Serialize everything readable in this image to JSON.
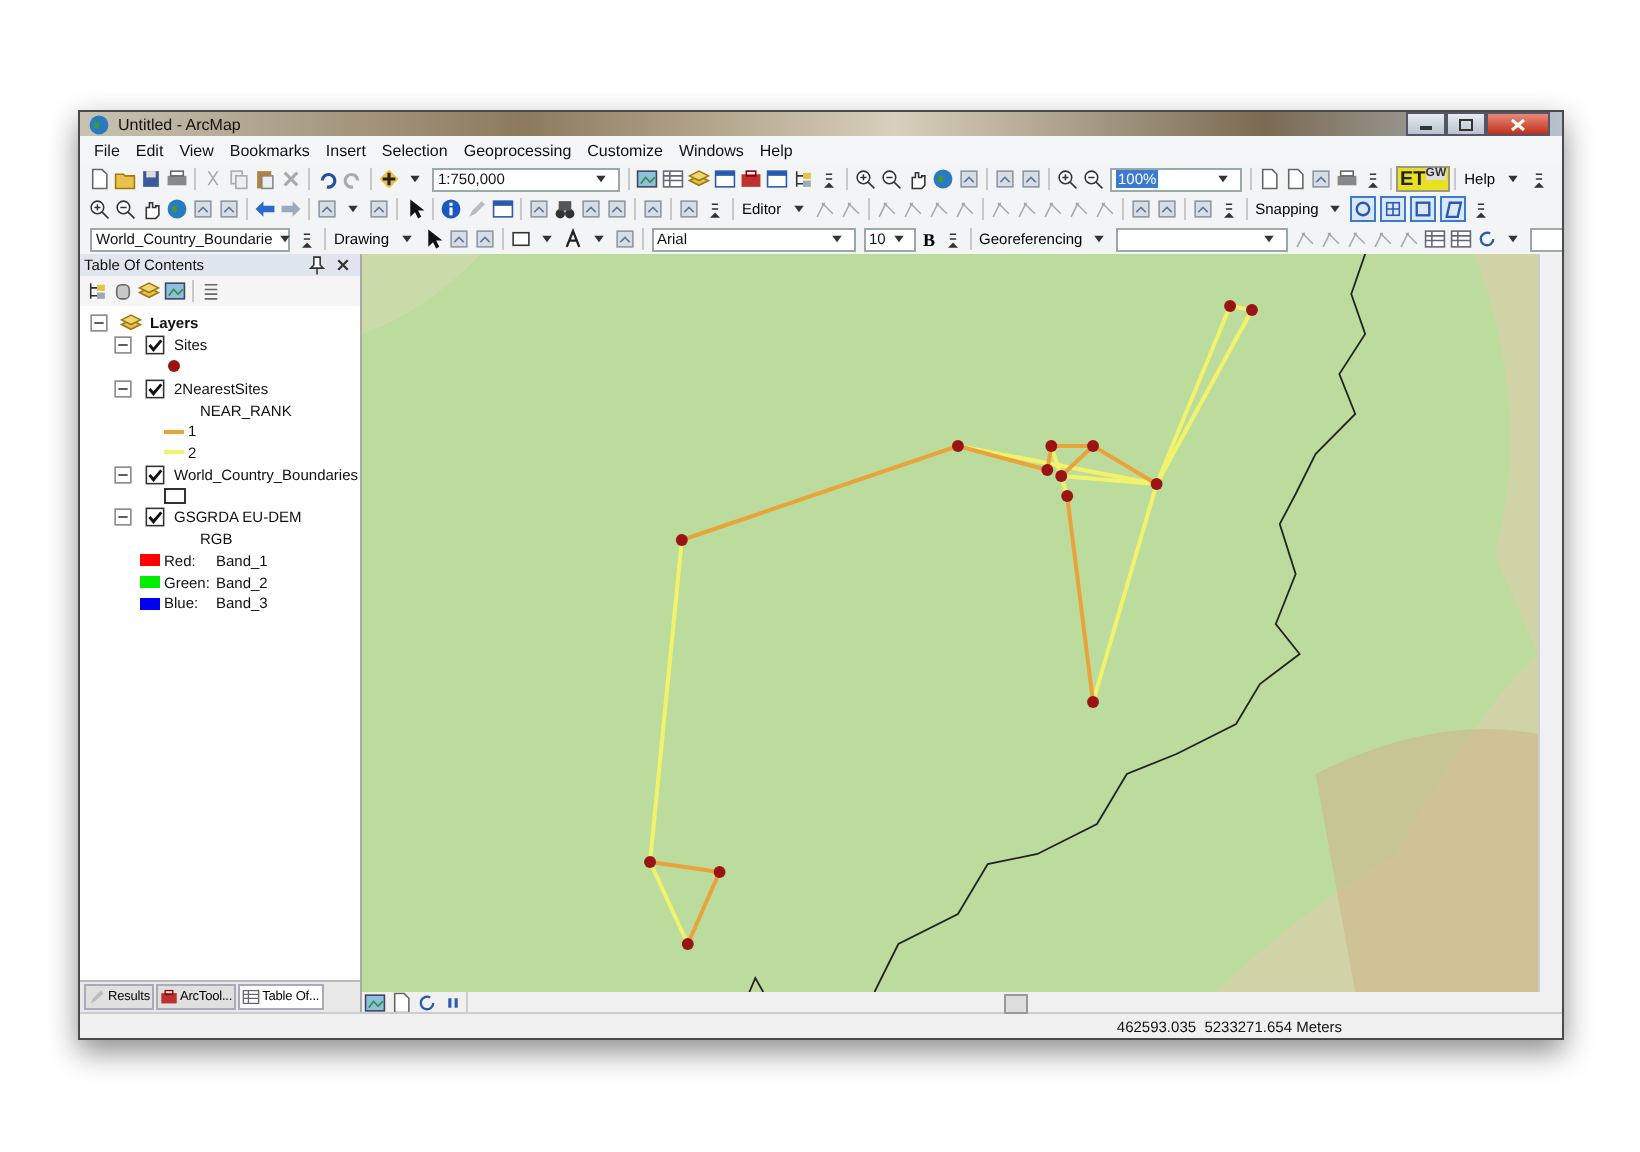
{
  "window": {
    "title": "Untitled - ArcMap"
  },
  "menu": [
    "File",
    "Edit",
    "View",
    "Bookmarks",
    "Insert",
    "Selection",
    "Geoprocessing",
    "Customize",
    "Windows",
    "Help"
  ],
  "toolbars": [
    {
      "items": [
        {
          "kind": "field",
          "value": "1:750,000"
        },
        {
          "kind": "field",
          "value": "100%"
        },
        {
          "kind": "logo",
          "label": "ET",
          "sup": "GW"
        },
        {
          "kind": "menu",
          "label": "Help"
        }
      ]
    },
    {
      "items": [
        {
          "kind": "menu",
          "label": "Editor"
        },
        {
          "kind": "menu",
          "label": "Snapping"
        }
      ]
    },
    {
      "items": [
        {
          "kind": "field",
          "value": "World_Country_Boundarie"
        },
        {
          "kind": "menu",
          "label": "Drawing"
        },
        {
          "kind": "field",
          "value": "Arial"
        },
        {
          "kind": "field",
          "value": "10"
        },
        {
          "kind": "button",
          "label": "B"
        },
        {
          "kind": "menu",
          "label": "Georeferencing"
        },
        {
          "kind": "field",
          "value": ""
        },
        {
          "kind": "field",
          "value": ""
        }
      ]
    }
  ],
  "toc": {
    "title": "Table Of Contents",
    "tree": [
      {
        "label": "Layers",
        "kind": "group",
        "expanded": true,
        "children": [
          {
            "label": "Sites",
            "kind": "layer",
            "checked": true,
            "expanded": true,
            "legend": [
              {
                "kind": "point",
                "color": "#9a1414"
              }
            ]
          },
          {
            "label": "2NearestSites",
            "kind": "layer",
            "checked": true,
            "expanded": true,
            "legend": [
              {
                "kind": "heading",
                "label": "NEAR_RANK"
              },
              {
                "kind": "line",
                "color": "#e8a33a",
                "label": "1"
              },
              {
                "kind": "line",
                "color": "#f3f36a",
                "label": "2"
              }
            ]
          },
          {
            "label": "World_Country_Boundaries",
            "kind": "layer",
            "checked": true,
            "expanded": true,
            "legend": [
              {
                "kind": "polygon"
              }
            ]
          },
          {
            "label": "GSGRDA EU-DEM",
            "kind": "layer",
            "checked": true,
            "expanded": true,
            "legend": [
              {
                "kind": "heading",
                "label": "RGB"
              },
              {
                "kind": "band",
                "color": "#ff0000",
                "label": "Red:",
                "value": "Band_1"
              },
              {
                "kind": "band",
                "color": "#00ee00",
                "label": "Green:",
                "value": "Band_2"
              },
              {
                "kind": "band",
                "color": "#0000ee",
                "label": "Blue:",
                "value": "Band_3"
              }
            ]
          }
        ]
      }
    ]
  },
  "dock_tabs": [
    {
      "label": "Results",
      "selected": false
    },
    {
      "label": "ArcTool...",
      "selected": false
    },
    {
      "label": "Table Of...",
      "selected": true
    }
  ],
  "status_bar": {
    "coordinates": "462593.035  5233271.654 Meters"
  }
}
